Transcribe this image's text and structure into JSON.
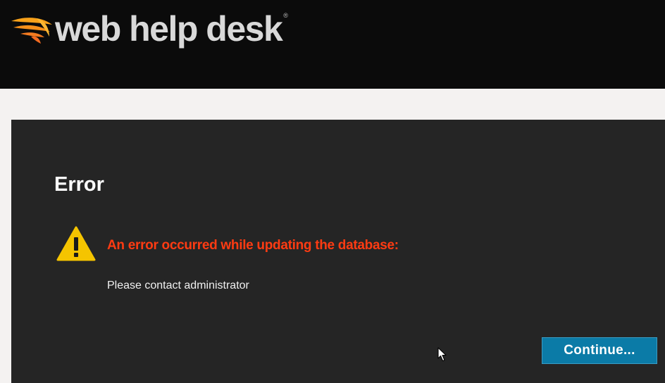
{
  "header": {
    "logo_text": "web help desk",
    "logo_trademark": "®",
    "logo_icon": "solarwinds-flame-icon",
    "background_color": "#0b0b0b"
  },
  "error_panel": {
    "title": "Error",
    "warning_icon": "warning-triangle-icon",
    "message": "An error occurred while updating the database:",
    "detail": "Please contact administrator",
    "message_color": "#ff3b12"
  },
  "actions": {
    "continue_label": "Continue...",
    "button_color": "#0b7ba7"
  },
  "cursor": {
    "icon": "mouse-pointer-icon"
  }
}
